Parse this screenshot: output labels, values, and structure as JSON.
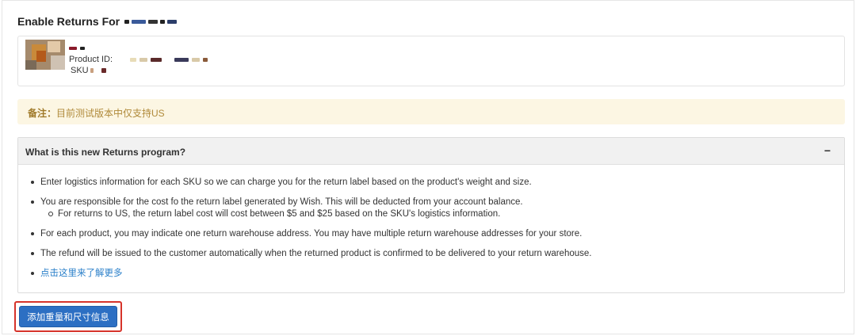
{
  "header": {
    "title": "Enable Returns For"
  },
  "product": {
    "product_id_label": "Product ID:",
    "sku_label": "SKU"
  },
  "note": {
    "label": "备注：",
    "text": "目前测试版本中仅支持US"
  },
  "panel": {
    "title": "What is this new Returns program?",
    "collapse_symbol": "−",
    "bullets": [
      "Enter logistics information for each SKU so we can charge you for the return label based on the product's weight and size.",
      "You are responsible for the cost fo the return label generated by Wish. This will be deducted from your account balance.",
      "For each product, you may indicate one return warehouse address. You may have multiple return warehouse addresses for your store.",
      "The refund will be issued to the customer automatically when the returned product is confirmed to be delivered to your return warehouse."
    ],
    "sub_bullet": "For returns to US, the return label cost will cost between $5 and $25 based on the SKU's logistics information.",
    "learn_more": "点击这里来了解更多"
  },
  "actions": {
    "add_info_button": "添加重量和尺寸信息"
  },
  "colors": {
    "accent_blue": "#2c6fc3",
    "note_bg": "#fcf6e3",
    "highlight_red": "#d6332a",
    "link": "#2a7fc9"
  }
}
